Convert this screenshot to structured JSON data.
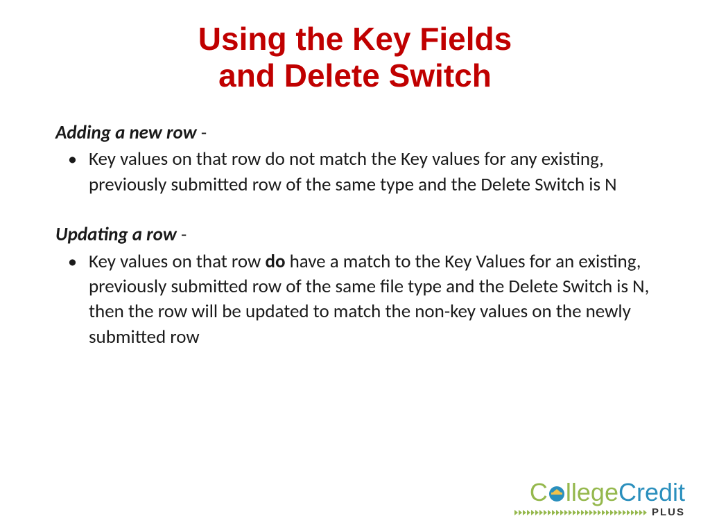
{
  "title_line1": "Using the Key Fields",
  "title_line2": "and Delete Switch",
  "section1": {
    "heading": "Adding a new row",
    "dash": " -",
    "bullet": "Key values on that row do not match the Key values for any existing, previously submitted row of the same type and the Delete Switch is N"
  },
  "section2": {
    "heading": "Updating a row",
    "dash": " -",
    "bullet_pre": "Key values on that row ",
    "bullet_bold": "do",
    "bullet_post": " have a match to the Key Values for an existing, previously submitted row of the same file type and the Delete Switch is N, then the row will be updated to match the non-key values on the newly submitted row"
  },
  "logo": {
    "c": "C",
    "llege": "llege",
    "credit": "Credit",
    "plus": "PLUS"
  }
}
